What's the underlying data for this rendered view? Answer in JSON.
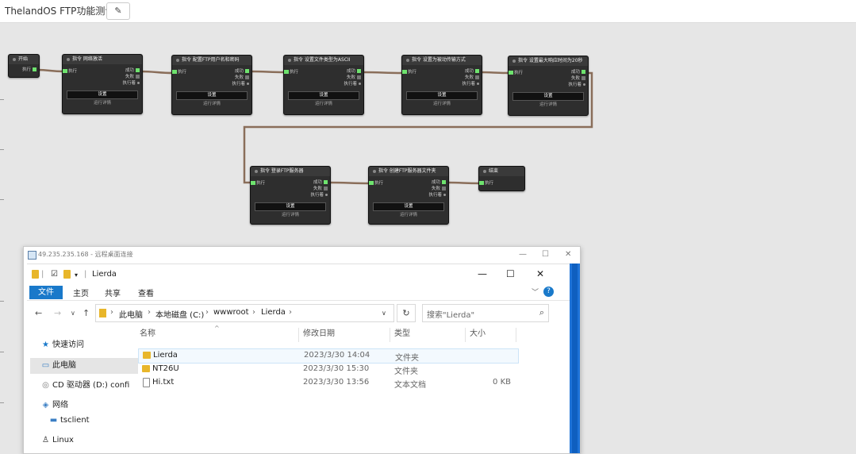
{
  "app": {
    "title": "ThelandOS FTP功能测试",
    "edit_icon": "pencil-icon"
  },
  "colors": {
    "canvas": "#e6e6e6",
    "node_bg": "#2e2e2e",
    "port_on": "#6ee36e",
    "wire": "#8a6e5a",
    "explorer_blue": "#1979ca"
  },
  "flow": {
    "ports": {
      "exec": "执行",
      "success": "成功",
      "fail": "失败",
      "executing": "执行着"
    },
    "buttons": {
      "settings": "设置",
      "details": "运行详情"
    },
    "nodes": [
      {
        "title": "开始"
      },
      {
        "title": "指令 网络激活"
      },
      {
        "title": "指令 配置FTP用户名和密码"
      },
      {
        "title": "指令 设置文件类型为ASCII"
      },
      {
        "title": "指令 设置为被动传输方式"
      },
      {
        "title": "指令 设置最大响应时间为20秒"
      },
      {
        "title": "指令 登录FTP服务器"
      },
      {
        "title": "指令 创建FTP服务器文件夹"
      },
      {
        "title": "结束"
      }
    ]
  },
  "rdp": {
    "title": "49.235.235.168 - 远程桌面连接",
    "controls": [
      "—",
      "☐",
      "✕"
    ]
  },
  "explorer": {
    "window_title": "Lierda",
    "window_controls": [
      "—",
      "☐",
      "✕"
    ],
    "ribbon_tabs": {
      "file": "文件",
      "home": "主页",
      "share": "共享",
      "view": "查看"
    },
    "breadcrumb": [
      "此电脑",
      "本地磁盘 (C:)",
      "wwwroot",
      "Lierda"
    ],
    "search_placeholder": "搜索\"Lierda\"",
    "sidebar": [
      {
        "label": "快速访问",
        "icon": "star-icon"
      },
      {
        "label": "此电脑",
        "icon": "computer-icon",
        "selected": true
      },
      {
        "label": "CD 驱动器 (D:) confi",
        "icon": "cd-drive-icon"
      },
      {
        "label": "网络",
        "icon": "network-icon"
      },
      {
        "label": "tsclient",
        "icon": "tsclient-icon"
      },
      {
        "label": "Linux",
        "icon": "linux-icon"
      }
    ],
    "columns": {
      "name": "名称",
      "modified": "修改日期",
      "type": "类型",
      "size": "大小"
    },
    "files": [
      {
        "name": "Lierda",
        "modified": "2023/3/30 14:04",
        "type": "文件夹",
        "size": "",
        "icon": "folder-icon",
        "selected": true
      },
      {
        "name": "NT26U",
        "modified": "2023/3/30 15:30",
        "type": "文件夹",
        "size": "",
        "icon": "folder-icon"
      },
      {
        "name": "Hi.txt",
        "modified": "2023/3/30 13:56",
        "type": "文本文档",
        "size": "0 KB",
        "icon": "text-file-icon"
      }
    ]
  }
}
